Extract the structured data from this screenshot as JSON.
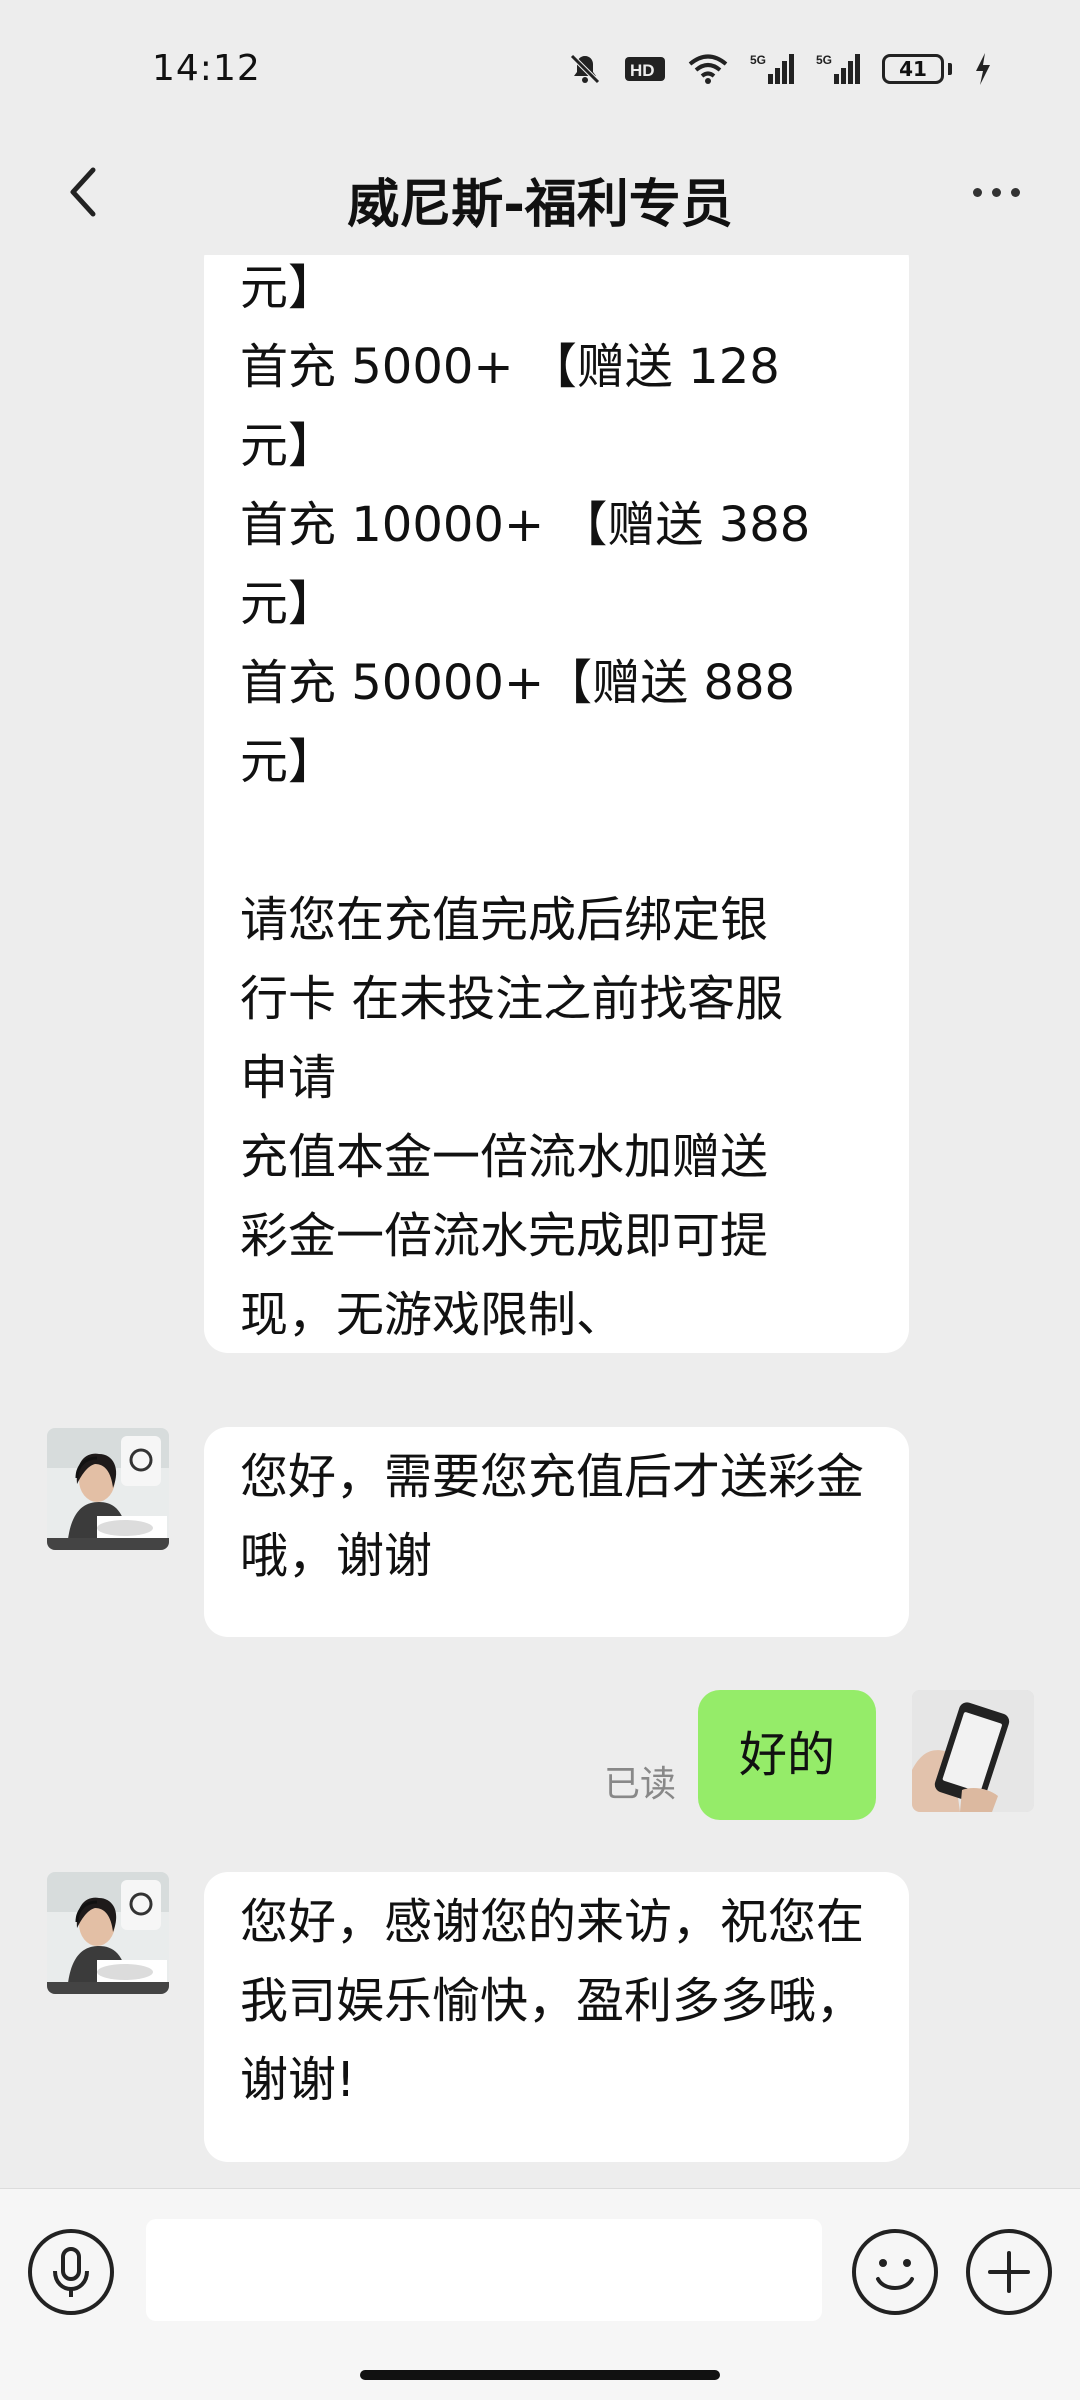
{
  "status_bar": {
    "time": "14:12",
    "icons": [
      "mute-icon",
      "hd-icon",
      "wifi-icon",
      "signal-5g-icon",
      "signal-5g-icon",
      "battery-icon",
      "charging-icon"
    ],
    "battery_level": "41"
  },
  "header": {
    "title": "威尼斯-福利专员",
    "back_icon": "chevron-left-icon",
    "more_icon": "more-dots-icon"
  },
  "messages": [
    {
      "sender": "agent",
      "text_lines": [
        "元】",
        "首充 5000+ 【赠送 128",
        "元】",
        "首充 10000+ 【赠送 388",
        "元】",
        "首充 50000+【赠送 888",
        "元】",
        "",
        "请您在充值完成后绑定银",
        "行卡 在未投注之前找客服",
        "申请",
        "充值本金一倍流水加赠送",
        "彩金一倍流水完成即可提",
        "现，无游戏限制、"
      ]
    },
    {
      "sender": "agent",
      "text": "您好，需要您充值后才送彩金哦，谢谢"
    },
    {
      "sender": "me",
      "text": "好的",
      "status": "已读"
    },
    {
      "sender": "agent",
      "text": "您好，感谢您的来访，祝您在我司娱乐愉快，盈利多多哦，谢谢!"
    }
  ],
  "input_bar": {
    "voice_icon": "microphone-icon",
    "input_value": "",
    "emoji_icon": "smiley-icon",
    "plus_icon": "plus-icon"
  },
  "colors": {
    "background": "#ededed",
    "agent_bubble": "#ffffff",
    "my_bubble": "#95ec69",
    "read_status": "#888888"
  }
}
